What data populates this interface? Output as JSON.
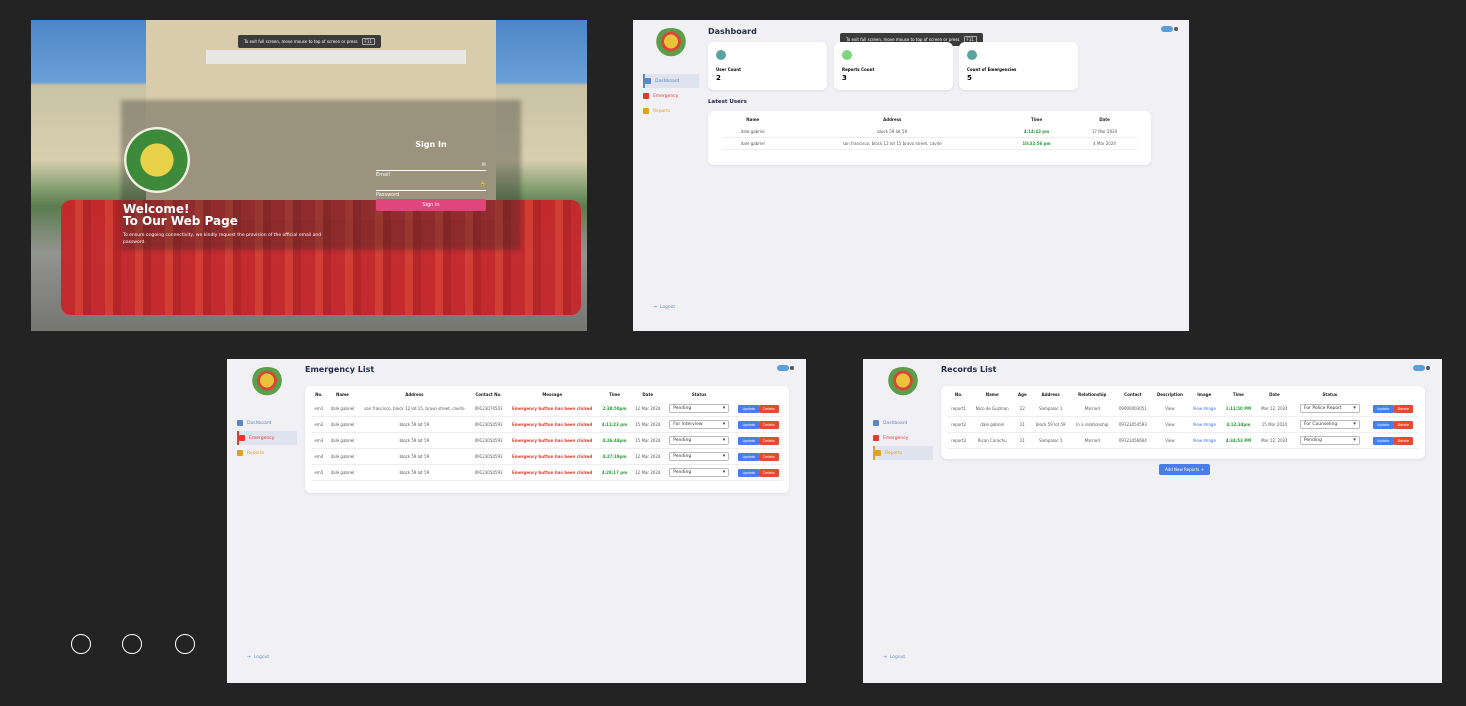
{
  "fullscreen_hint": {
    "text": "To exit full screen, move mouse to top of screen or press",
    "key": "F11"
  },
  "login": {
    "heading": "Welcome!",
    "subheading": "To Our Web Page",
    "note": "To ensure ongoing connectivity, we kindly request the provision of the official email and password.",
    "form_title": "Sign In",
    "email_placeholder": "Email",
    "password_placeholder": "Password",
    "signin_label": "Sign In"
  },
  "nav": {
    "dashboard": "Dashboard",
    "emergency": "Emergency",
    "reports": "Reports",
    "logout": "Logout"
  },
  "dashboard": {
    "title": "Dashboard",
    "stats": [
      {
        "label": "User Count",
        "value": "2",
        "color": "#5aa3a0"
      },
      {
        "label": "Reports Count",
        "value": "3",
        "color": "#7ed67a"
      },
      {
        "label": "Count of Emergencies",
        "value": "5",
        "color": "#5aa3a0"
      }
    ],
    "latest_title": "Latest Users",
    "columns": [
      "Name",
      "Address",
      "Time",
      "Date"
    ],
    "rows": [
      [
        "dale gabriel",
        "block 59 lot 59",
        "4:14:43 pm",
        "17 Mar 2024"
      ],
      [
        "dale gabriel",
        "san francisco, block 12 lot 15 bravo street, cavite",
        "10:32:56 pm",
        "4 Mar 2024"
      ]
    ]
  },
  "emergency": {
    "title": "Emergency List",
    "columns": [
      "No.",
      "Name",
      "Address",
      "Contact No.",
      "Message",
      "Time",
      "Date",
      "Status"
    ],
    "rows": [
      [
        "em1",
        "dale gabriel",
        "san francisco, block 12 lot 15, bravo street, cavite",
        "09123074503",
        "Emergency button has been clicked",
        "2:38:50pm",
        "12 Mar 2024",
        "Pending"
      ],
      [
        "em2",
        "dale gabriel",
        "block 59 lot 59",
        "09123054593",
        "Emergency button has been clicked",
        "4:11:23 pm",
        "15 Mar 2024",
        "For interview"
      ],
      [
        "em3",
        "dale gabriel",
        "block 59 lot 59",
        "09123054593",
        "Emergency button has been clicked",
        "4:26:44pm",
        "15 Mar 2024",
        "Pending"
      ],
      [
        "em4",
        "dale gabriel",
        "block 59 lot 59",
        "09123054593",
        "Emergency button has been clicked",
        "4:27:19pm",
        "12 Mar 2024",
        "Pending"
      ],
      [
        "em5",
        "dale gabriel",
        "block 59 lot 59",
        "09123054593",
        "Emergency button has been clicked",
        "4:28:17 pm",
        "12 Mar 2024",
        "Pending"
      ]
    ],
    "update_label": "Update",
    "delete_label": "Delete"
  },
  "records": {
    "title": "Records List",
    "columns": [
      "No.",
      "Name",
      "Age",
      "Address",
      "Relationship",
      "Contact",
      "Description",
      "Image",
      "Time",
      "Date",
      "Status"
    ],
    "rows": [
      [
        "report1",
        "Nico de Guzman",
        "22",
        "Sampaloc 1",
        "Married",
        "09000003051",
        "View",
        "View Image",
        "2:11:50 PM",
        "Mar 12, 2024",
        "For Police Report"
      ],
      [
        "report2",
        "dale gabriel",
        "21",
        "block 59 lot 59",
        "In a relationship",
        "09123054593",
        "View",
        "View Image",
        "4:12:34pm",
        "15 Mar 2024",
        "For Counseling"
      ],
      [
        "report3",
        "Rican Carachu",
        "21",
        "Sampaloc 1",
        "Married",
        "09123456664",
        "View",
        "View Image",
        "4:34:53 PM",
        "Mar 12, 2024",
        "Pending"
      ]
    ],
    "add_label": "Add New Reports +"
  },
  "colors": {
    "page_bg": "#232323",
    "accent_pink": "#e0457b",
    "nav_dashboard": "#5b86c4",
    "nav_emergency": "#e23a2c",
    "nav_reports": "#e0a020"
  },
  "carousel_dots": 3
}
